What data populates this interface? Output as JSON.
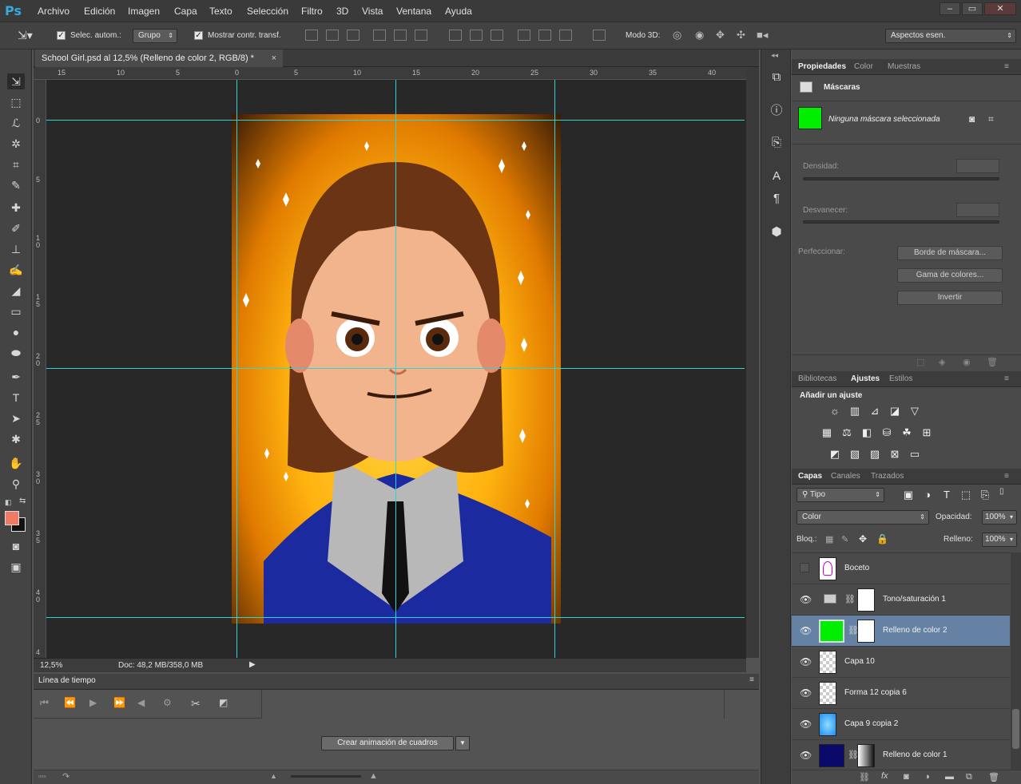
{
  "app": {
    "logo": "Ps"
  },
  "menu": [
    "Archivo",
    "Edición",
    "Imagen",
    "Capa",
    "Texto",
    "Selección",
    "Filtro",
    "3D",
    "Vista",
    "Ventana",
    "Ayuda"
  ],
  "window_buttons": [
    "–",
    "▭",
    "✕"
  ],
  "options": {
    "auto_select_label": "Selec. autom.:",
    "auto_select_value": "Grupo",
    "show_transform_label": "Mostrar contr. transf.",
    "mode3d_label": "Modo 3D:",
    "workspace": "Aspectos esen."
  },
  "document": {
    "tab_title": "School Girl.psd al 12,5% (Relleno de color 2, RGB/8) *",
    "tab_close": "×",
    "zoom": "12,5%",
    "doc_info": "Doc: 48,2 MB/358,0 MB"
  },
  "rulers": {
    "top": [
      "15",
      "10",
      "5",
      "0",
      "5",
      "10",
      "15",
      "20",
      "25",
      "30",
      "35",
      "40"
    ],
    "left": [
      "0",
      "5",
      "1\n0",
      "1\n5",
      "2\n0",
      "2\n5",
      "3\n0",
      "3\n5",
      "4\n0",
      "4"
    ]
  },
  "timeline": {
    "title": "Línea de tiempo",
    "create_button": "Crear animación de cuadros"
  },
  "properties": {
    "tabs": [
      "Propiedades",
      "Color",
      "Muestras"
    ],
    "section": "Máscaras",
    "no_mask": "Ninguna máscara seleccionada",
    "density_label": "Densidad:",
    "feather_label": "Desvanecer:",
    "refine_label": "Perfeccionar:",
    "mask_edge_button": "Borde de máscara...",
    "color_range_button": "Gama de colores...",
    "invert_button": "Invertir"
  },
  "adjustments": {
    "tabs": [
      "Bibliotecas",
      "Ajustes",
      "Estilos"
    ],
    "add_label": "Añadir un ajuste"
  },
  "layers_panel": {
    "tabs": [
      "Capas",
      "Canales",
      "Trazados"
    ],
    "filter": "Tipo",
    "blend_mode": "Color",
    "opacity_label": "Opacidad:",
    "opacity_value": "100%",
    "lock_label": "Bloq.:",
    "fill_label": "Relleno:",
    "fill_value": "100%",
    "layers": [
      {
        "name": "Boceto",
        "visible": false
      },
      {
        "name": "Tono/saturación 1",
        "visible": true
      },
      {
        "name": "Relleno de color 2",
        "visible": true,
        "selected": true
      },
      {
        "name": "Capa 10",
        "visible": true
      },
      {
        "name": "Forma 12 copia 6",
        "visible": true
      },
      {
        "name": "Capa 9 copia 2",
        "visible": true
      },
      {
        "name": "Relleno de color 1",
        "visible": true
      }
    ]
  },
  "colors": {
    "foreground": "#f07a63",
    "background": "#111111",
    "mask_fill": "#00ee00",
    "guide": "#2cd6d6",
    "selected_layer": "#6581a3"
  }
}
